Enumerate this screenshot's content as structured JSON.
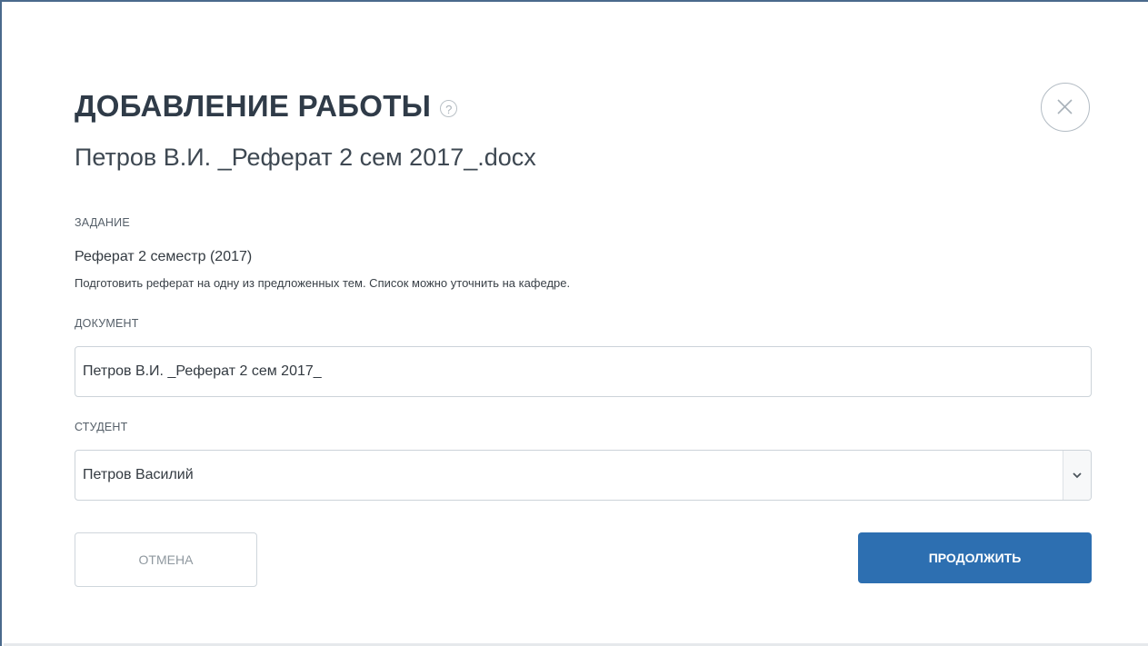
{
  "dialog": {
    "title": "ДОБАВЛЕНИЕ РАБОТЫ",
    "help_glyph": "?",
    "filename": "Петров В.И. _Реферат 2 сем 2017_.docx"
  },
  "task": {
    "label": "ЗАДАНИЕ",
    "name": "Реферат 2 семестр (2017)",
    "description": "Подготовить реферат на одну из предложенных тем. Список можно уточнить на кафедре."
  },
  "document": {
    "label": "ДОКУМЕНТ",
    "value": "Петров В.И. _Реферат 2 сем 2017_"
  },
  "student": {
    "label": "СТУДЕНТ",
    "selected": "Петров Василий"
  },
  "actions": {
    "cancel_label": "ОТМЕНА",
    "continue_label": "ПРОДОЛЖИТЬ"
  },
  "icons": {
    "help": "help-circle-icon",
    "close": "close-circle-icon",
    "dropdown": "chevron-down-icon"
  },
  "colors": {
    "primary": "#2d6fb1",
    "title": "#2f3b48",
    "border": "#ccd3d9"
  }
}
